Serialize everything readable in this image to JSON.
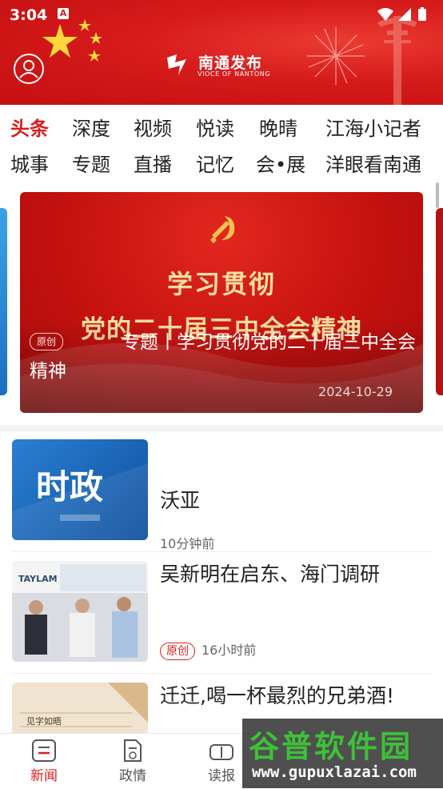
{
  "status": {
    "time": "3:04",
    "notif_letter": "A"
  },
  "header": {
    "logo_title": "南通发布",
    "logo_subtitle": "VIOCE OF NANTONG",
    "avatar_icon": "user-icon"
  },
  "categories": {
    "row1": [
      "头条",
      "深度",
      "视频",
      "悦读",
      "晚晴",
      "江海小记者"
    ],
    "row2": [
      "城事",
      "专题",
      "直播",
      "记忆",
      "会•展",
      "洋眼看南通"
    ],
    "active": "头条"
  },
  "banner": {
    "headline1": "学习贯彻",
    "headline2": "党的二十届三中全会精神",
    "tag": "原创",
    "caption": "专题丨学习贯彻党的二十届三中全会精神",
    "date": "2024-10-29"
  },
  "news": [
    {
      "thumb_text": "时政",
      "title": "沃亚",
      "tag": "",
      "time": "10分钟前"
    },
    {
      "thumb_text": "TAYLAM",
      "title": "吴新明在启东、海门调研",
      "tag": "原创",
      "time": "16小时前"
    },
    {
      "thumb_text": "见字如晤",
      "title": "迁迁,喝一杯最烈的兄弟酒!",
      "tag": "",
      "time": ""
    }
  ],
  "bottom_nav": [
    {
      "label": "新闻",
      "icon": "news-icon",
      "active": true
    },
    {
      "label": "政情",
      "icon": "gov-icon",
      "active": false
    },
    {
      "label": "读报",
      "icon": "newspaper-icon",
      "active": false
    }
  ],
  "watermark": {
    "big": "谷普软件园",
    "small": "www.gupuxlazai.com"
  },
  "colors": {
    "brand_red": "#d51a1a",
    "active_tab": "#d81e1e",
    "watermark_green": "#3ec03a"
  }
}
